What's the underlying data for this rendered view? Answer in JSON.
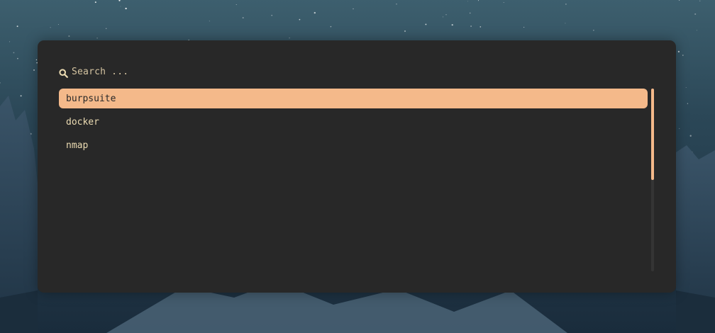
{
  "theme": {
    "panel_bg": "#282828",
    "accent": "#f4b98a",
    "text": "#ebdbb2",
    "selected_text": "#282828"
  },
  "search": {
    "icon": "search-icon",
    "placeholder": "Search ...",
    "value": ""
  },
  "results": [
    {
      "label": "burpsuite",
      "selected": true
    },
    {
      "label": "docker",
      "selected": false
    },
    {
      "label": "nmap",
      "selected": false
    }
  ],
  "scroll": {
    "position": 0,
    "visible_fraction": 0.5
  }
}
